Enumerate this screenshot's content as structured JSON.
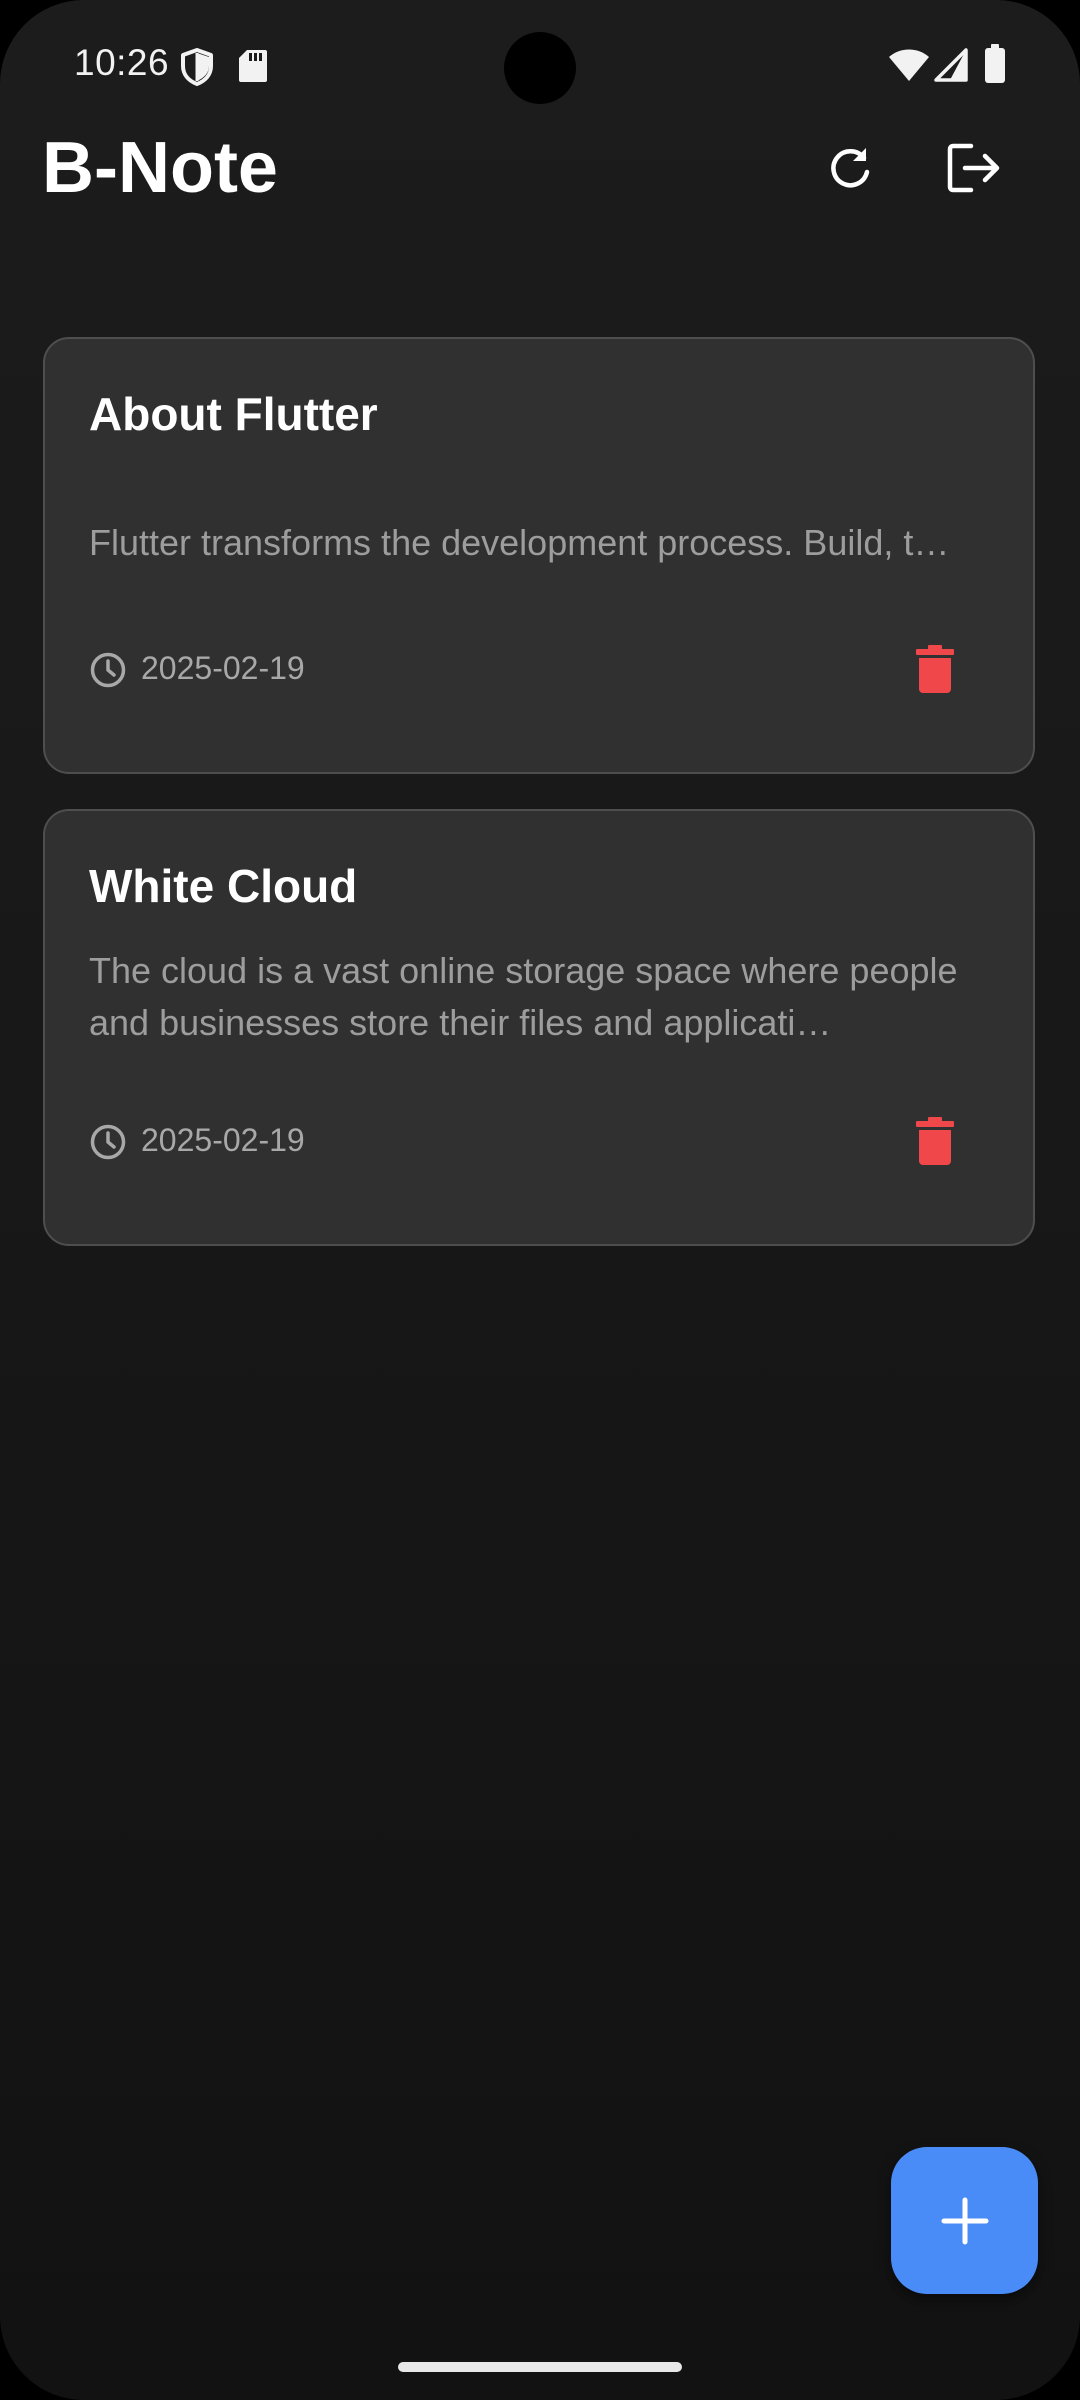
{
  "status_bar": {
    "time": "10:26",
    "icons": [
      "vpn-shield-icon",
      "sd-card-icon",
      "wifi-icon",
      "cellular-signal-icon",
      "battery-icon"
    ]
  },
  "app_bar": {
    "title": "B-Note",
    "actions": [
      "refresh-icon",
      "logout-icon"
    ]
  },
  "notes": [
    {
      "title": "About Flutter",
      "body": "Flutter transforms the development process. Build, t…",
      "date": "2025-02-19"
    },
    {
      "title": "White Cloud",
      "body": "The cloud is a vast online storage space where people and businesses store their files and applicati…",
      "date": "2025-02-19"
    }
  ],
  "fab": {
    "icon": "plus-icon"
  },
  "colors": {
    "background": "#181818",
    "card": "#303030",
    "card_border": "#4e4e4e",
    "accent": "#4a8cf7",
    "delete": "#f0484a",
    "muted_text": "#9d9d9d"
  }
}
